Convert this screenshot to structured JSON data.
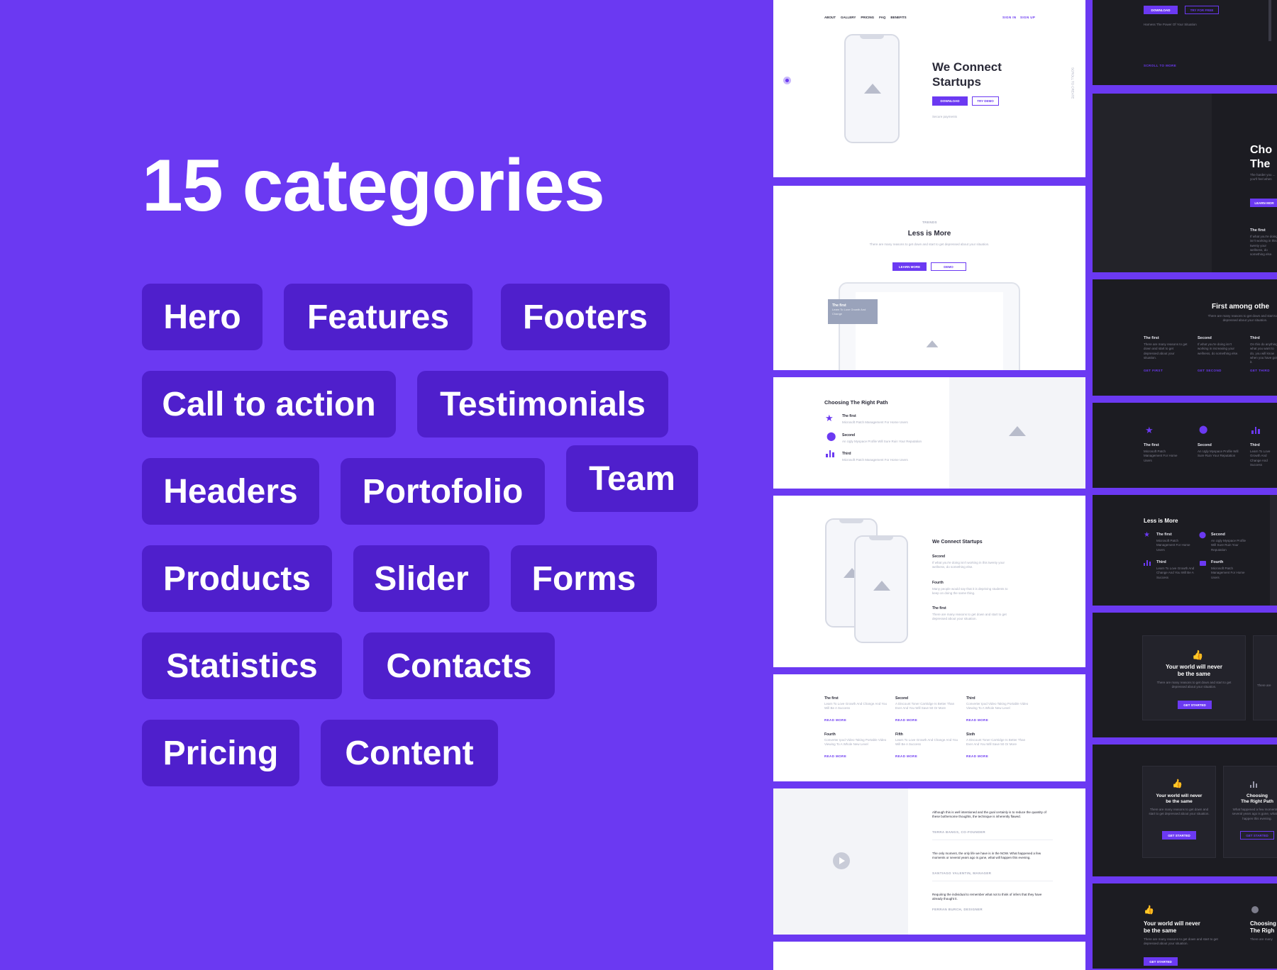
{
  "headline": "15 categories",
  "categories": [
    "Hero",
    "Features",
    "Footers",
    "Call to action",
    "Testimonials",
    "Headers",
    "Portofolio",
    "Team",
    "Products",
    "Slider",
    "Forms",
    "Statistics",
    "Contacts",
    "Pricing",
    "Content"
  ],
  "colors": {
    "background": "#6b39f2",
    "chip": "#4f1fcc",
    "dark_tile": "#1c1c22",
    "accent": "#6b39f2"
  },
  "tile1": {
    "nav": [
      "ABOUT",
      "GALLERY",
      "PRICING",
      "FAQ",
      "BENEFITS"
    ],
    "nav_right": [
      "SIGN IN",
      "SIGN UP"
    ],
    "title_line1": "We Connect",
    "title_line2": "Startups",
    "btn_primary": "DOWNLOAD",
    "btn_secondary": "TRY DEMO",
    "note": "Secure payments",
    "side_text": "SCROLL TO CREATE"
  },
  "tile2": {
    "eyebrow": "TRENDS",
    "title": "Less is More",
    "subtitle": "There are many reasons to get down and start to get depressed about your situation.",
    "btn_primary": "LEARN MORE",
    "btn_secondary": "DEMO",
    "card_title": "The first",
    "card_text": "Learn To Love Growth And Change"
  },
  "tile3": {
    "title": "Choosing The Right Path",
    "items": [
      {
        "title": "The first",
        "text": "Microsoft Patch Management For Home Users"
      },
      {
        "title": "Second",
        "text": "An Ugly Myspace Profile Will Sure Ruin Your Reputation"
      },
      {
        "title": "Third",
        "text": "Microsoft Patch Management For Home Users"
      }
    ]
  },
  "tile4": {
    "title": "We Connect Startups",
    "items": [
      {
        "title": "Second",
        "text": "If what you're doing isn't working in this twenty your wellness, do something else."
      },
      {
        "title": "Fourth",
        "text": "Many people would say that it is depriving students to keep on doing the same thing."
      },
      {
        "title": "The first",
        "text": "There are many reasons to get down and start to get depressed about your situation."
      }
    ]
  },
  "tile5": {
    "items": [
      {
        "title": "The first",
        "text": "Learn To Love Growth And Change And You Will Be A Success",
        "link": "READ MORE"
      },
      {
        "title": "Second",
        "text": "A Discount Toner Cartridge Is Better Than Ever And You Will Save 50 Or More",
        "link": "READ MORE"
      },
      {
        "title": "Third",
        "text": "Converter Ipod Video Taking Portable Video Viewing To A Whole New Level",
        "link": "READ MORE"
      },
      {
        "title": "Fourth",
        "text": "Converter Ipod Video Taking Portable Video Viewing To A Whole New Level",
        "link": "READ MORE"
      },
      {
        "title": "Fifth",
        "text": "Learn To Love Growth And Change And You Will Be A Success",
        "link": "READ MORE"
      },
      {
        "title": "Sixth",
        "text": "A Discount Toner Cartridge Is Better Than Ever And You Will Save 50 Or More",
        "link": "READ MORE"
      }
    ]
  },
  "tile6": {
    "quotes": [
      {
        "text": "Although this is well intentioned and the goal certainly is to reduce the quantity of these bothersome thoughts, the technique is inherently flawed.",
        "author": "TERRA BANGS, CO-FOUNDER"
      },
      {
        "text": "The only moment, the only life we have is in the NOW. What happened a few moments or several years ago is gone, what will happen this evening.",
        "author": "SANTIAGO VALENTIN, MANAGER"
      },
      {
        "text": "Requiring the individual to remember what not to think of infers that they have already thought it.",
        "author": "FERRAN BURCH, DESIGNER"
      }
    ]
  },
  "dark1": {
    "btn_primary": "DOWNLOAD",
    "btn_secondary": "TRY FOR FREE",
    "tagline": "Harness The Power Of Your Situation",
    "link": "SCROLL TO MORE"
  },
  "dark2": {
    "title_line1": "Cho",
    "title_line2": "The",
    "sub": "The harder you ... you'll feel when",
    "btn": "LEARN MOR",
    "item_title": "The first",
    "item_text": "If what you're doing isn't working in this twenty your wellness, do something else."
  },
  "dark3": {
    "title": "First among othe",
    "sub": "There are many reasons to get down and start to get depressed about your situation.",
    "items": [
      {
        "title": "The first",
        "text": "There are many reasons to get down and start to get depressed about your situation.",
        "link": "GET FIRST"
      },
      {
        "title": "Second",
        "text": "If what you're doing isn't working in increasing your wellness, do something else.",
        "link": "GET SECOND"
      },
      {
        "title": "Third",
        "text": "On this do anything what you want to do, you will know when you have got it.",
        "link": "GET THIRD"
      }
    ]
  },
  "dark4": {
    "items": [
      {
        "title": "The first",
        "text": "Microsoft Patch Management For Home Users"
      },
      {
        "title": "Second",
        "text": "An Ugly Myspace Profile Will Sure Ruin Your Reputation"
      },
      {
        "title": "Third",
        "text": "Learn To Love Growth And Change And Success"
      }
    ]
  },
  "dark5": {
    "title": "Less is More",
    "items": [
      {
        "title": "The first",
        "text": "Microsoft Patch Management For Home Users"
      },
      {
        "title": "Second",
        "text": "An Ugly Myspace Profile Will Sure Ruin Your Reputation"
      },
      {
        "title": "Third",
        "text": "Learn To Love Growth And Change And You Will Be A Success"
      },
      {
        "title": "Fourth",
        "text": "Microsoft Patch Management For Home Users"
      }
    ]
  },
  "dark6": {
    "title_line1": "Your world will never",
    "title_line2": "be the same",
    "sub": "There are many reasons to get down and start to get depressed about your situation.",
    "btn": "GET STARTED",
    "peek": "There are"
  },
  "dark7": {
    "card1": {
      "title_line1": "Your world will never",
      "title_line2": "be the same",
      "sub": "There are many reasons to get down and start to get depressed about your situation.",
      "btn": "GET STARTED"
    },
    "card2": {
      "title_line1": "Choosing",
      "title_line2": "The Right Path",
      "sub": "What happened a few moments or several years ago is gone, what will happen this evening.",
      "btn": "GET STARTED"
    }
  },
  "dark8": {
    "title_line1": "Your world will never",
    "title_line2": "be the same",
    "sub": "There are many reasons to get down and start to get depressed about your situation.",
    "btn": "GET STARTED",
    "peek_line1": "Choosing",
    "peek_line2": "The Righ",
    "peek_sub": "There are many"
  }
}
